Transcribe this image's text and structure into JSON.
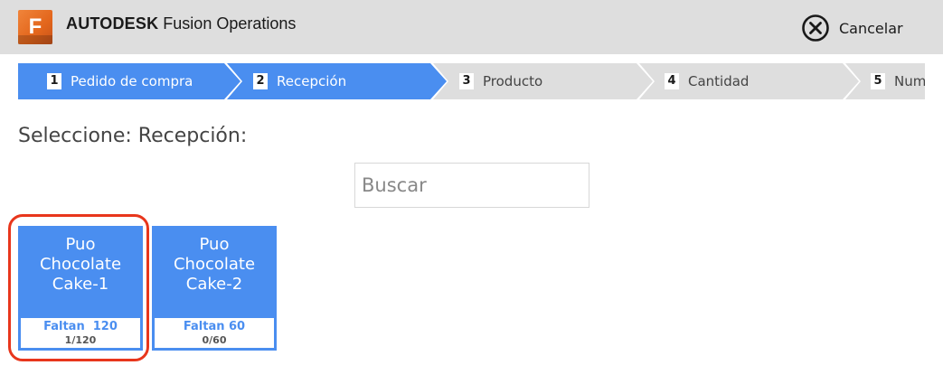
{
  "header": {
    "logo_letter": "F",
    "brand": "AUTODESK",
    "product": "Fusion Operations",
    "cancel_label": "Cancelar"
  },
  "steps": [
    {
      "number": "1",
      "label": "Pedido de compra",
      "state": "active"
    },
    {
      "number": "2",
      "label": "Recepción",
      "state": "active"
    },
    {
      "number": "3",
      "label": "Producto",
      "state": "inactive"
    },
    {
      "number": "4",
      "label": "Cantidad",
      "state": "inactive"
    },
    {
      "number": "5",
      "label": "Num",
      "state": "inactive"
    }
  ],
  "page": {
    "title": "Seleccione: Recepción:"
  },
  "search": {
    "placeholder": "Buscar"
  },
  "cards": [
    {
      "name_line1": "Puo",
      "name_line2": "Chocolate",
      "name_line3": "Cake-1",
      "remaining": "Faltan  120",
      "progress": "1/120",
      "highlighted": true
    },
    {
      "name_line1": "Puo",
      "name_line2": "Chocolate",
      "name_line3": "Cake-2",
      "remaining": "Faltan 60",
      "progress": "0/60",
      "highlighted": false
    }
  ],
  "colors": {
    "header_bg": "#dedede",
    "step_active": "#4a8ef0",
    "step_inactive": "#dedede",
    "card_bg": "#4a8ef0",
    "highlight": "#e8361c",
    "logo": "#e3661c"
  },
  "icons": {
    "cancel": "close-circle-icon",
    "logo": "fusion-logo-icon"
  }
}
